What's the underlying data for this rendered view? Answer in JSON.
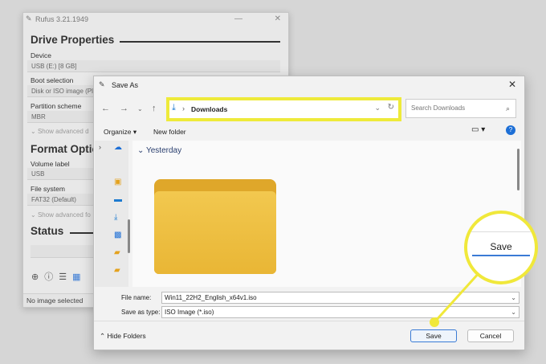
{
  "colors": {
    "highlight": "#f0e83a",
    "accent": "#3a7bd5",
    "folder": "#e9b635"
  },
  "rufus": {
    "title": "Rufus 3.21.1949",
    "drive_properties": "Drive Properties",
    "device_label": "Device",
    "device_value": "USB (E:) [8 GB]",
    "boot_label": "Boot selection",
    "boot_value": "Disk or ISO image (Pl",
    "partition_label": "Partition scheme",
    "partition_value": "MBR",
    "show_advanced_drive": "Show advanced d",
    "format_options": "Format Optio",
    "volume_label": "Volume label",
    "volume_value": "USB",
    "filesystem_label": "File system",
    "filesystem_value": "FAT32 (Default)",
    "show_advanced_format": "Show advanced fo",
    "status": "Status",
    "status_bar": "No image selected"
  },
  "dialog": {
    "title": "Save As",
    "path_folder": "Downloads",
    "search_placeholder": "Search Downloads",
    "organize": "Organize",
    "new_folder": "New folder",
    "group_header": "Yesterday",
    "file_name_label": "File name:",
    "file_name_value": "Win11_22H2_English_x64v1.iso",
    "save_type_label": "Save as type:",
    "save_type_value": "ISO Image (*.iso)",
    "hide_folders": "Hide Folders",
    "save_button": "Save",
    "cancel_button": "Cancel"
  },
  "callout": {
    "label": "Save"
  }
}
